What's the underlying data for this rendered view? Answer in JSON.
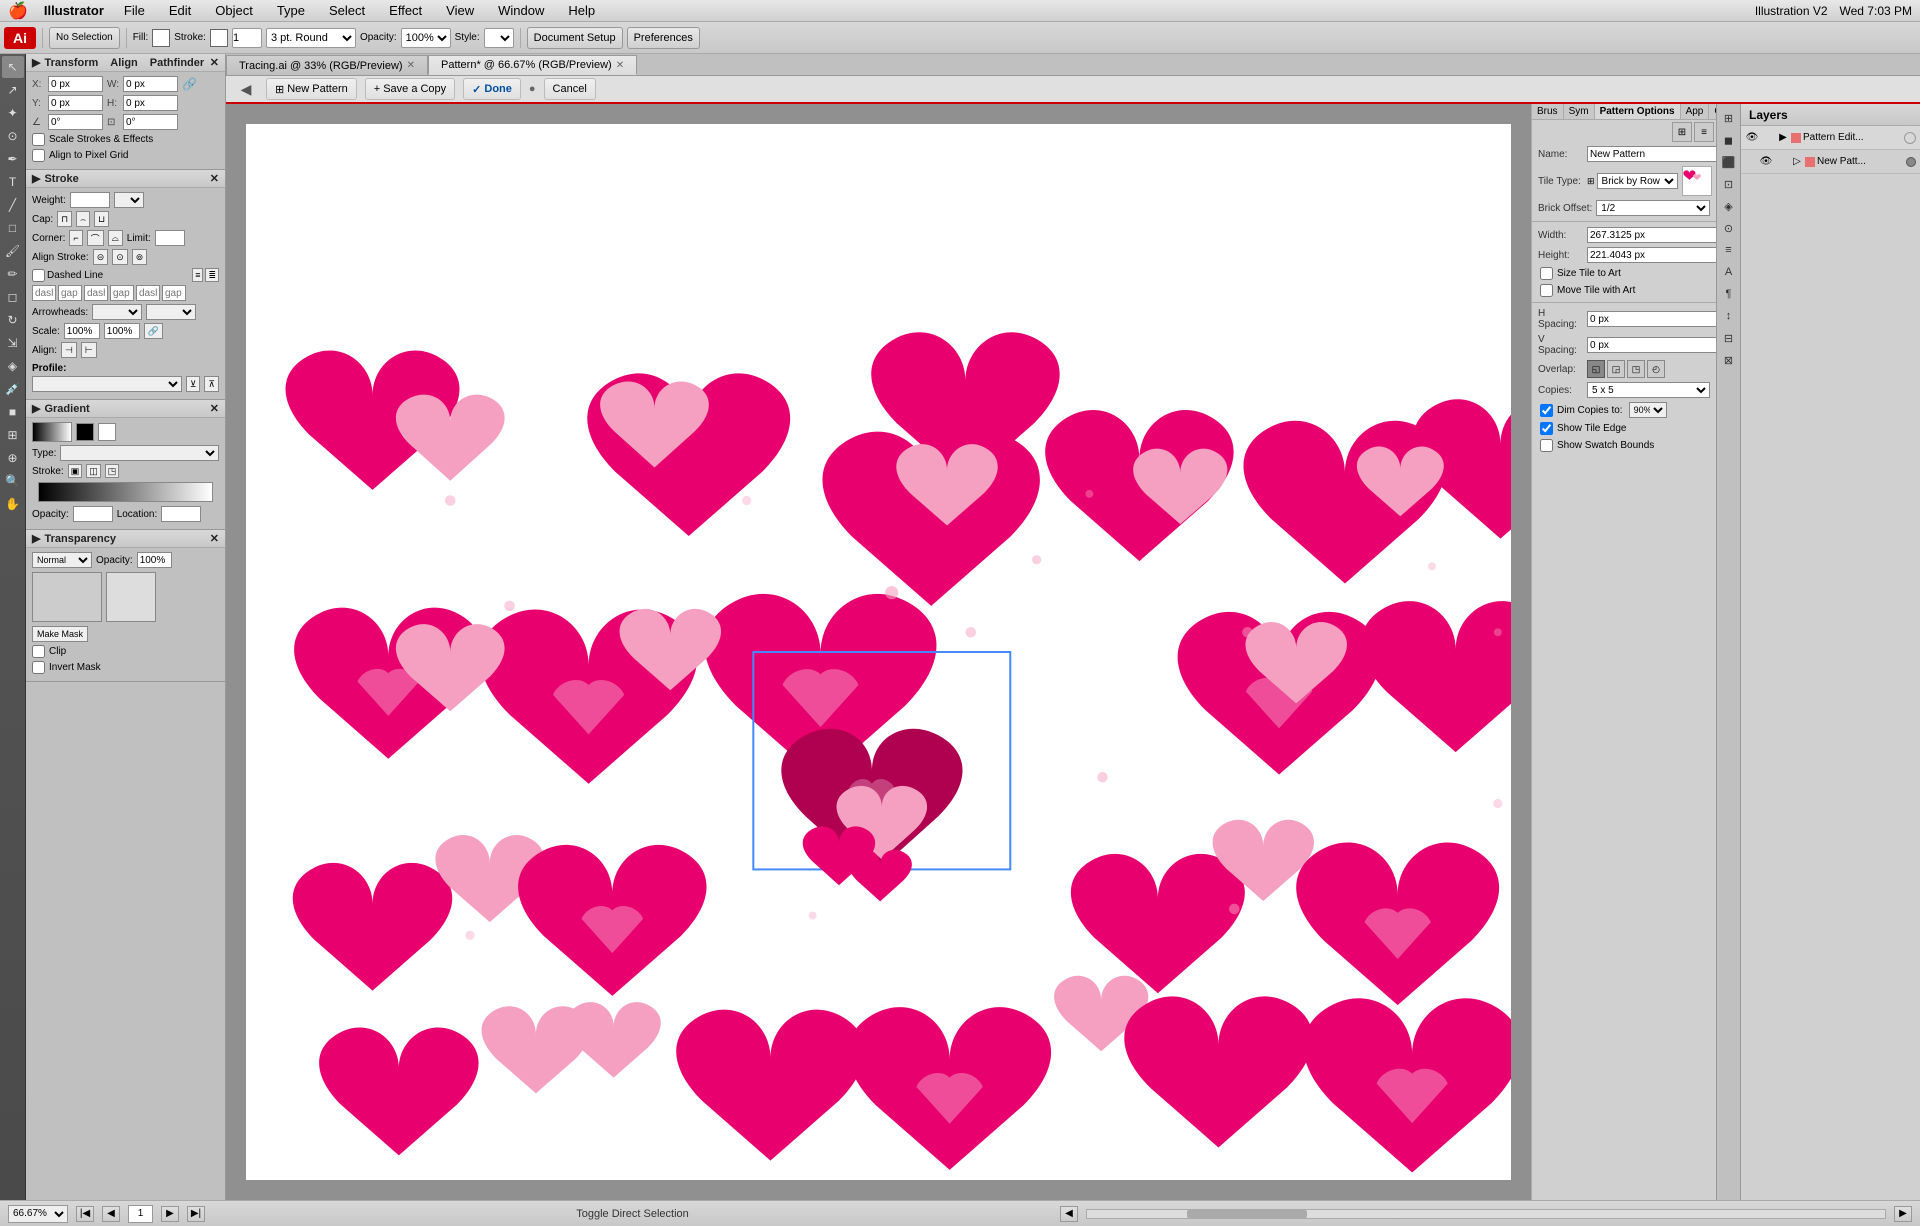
{
  "menubar": {
    "apple": "🍎",
    "app": "Illustrator",
    "menus": [
      "File",
      "Edit",
      "Object",
      "Type",
      "Select",
      "Effect",
      "View",
      "Window",
      "Help"
    ],
    "right": {
      "time": "Wed 7:03 PM",
      "version": "Illustration V2"
    }
  },
  "toolbar": {
    "selection_label": "No Selection",
    "fill_label": "Fill:",
    "stroke_label": "Stroke:",
    "stroke_size": "1",
    "pt_round": "3 pt. Round",
    "opacity_label": "Opacity:",
    "opacity_value": "100%",
    "style_label": "Style:",
    "doc_setup_label": "Document Setup",
    "preferences_label": "Preferences"
  },
  "tabs": [
    {
      "label": "Tracing.ai @ 33% (RGB/Preview)",
      "active": false
    },
    {
      "label": "Pattern* @ 66.67% (RGB/Preview)",
      "active": true
    }
  ],
  "pattern_toolbar": {
    "new_pattern": "New Pattern",
    "save_copy": "Save a Copy",
    "done": "Done",
    "cancel": "Cancel"
  },
  "transform_panel": {
    "title": "Transform",
    "x_label": "X:",
    "x_val": "0 px",
    "y_label": "Y:",
    "y_val": "0 px",
    "w_label": "W:",
    "w_val": "0 px",
    "h_label": "H:",
    "h_val": "0 px",
    "angle_label": "∠",
    "angle_val": "0°",
    "scale_strokes": "Scale Strokes & Effects",
    "align_pixel": "Align to Pixel Grid"
  },
  "stroke_panel": {
    "title": "Stroke",
    "weight_label": "Weight:",
    "cap_label": "Cap:",
    "corner_label": "Corner:",
    "limit_label": "Limit:",
    "align_stroke": "Align Stroke:",
    "dashed_line": "Dashed Line",
    "dash_label": "dash",
    "gap_label": "gap",
    "arrowheads": "Arrowheads:",
    "scale_label": "Scale:",
    "scale_val": "100%",
    "align_label": "Align:"
  },
  "gradient_panel": {
    "title": "Gradient",
    "type_label": "Type:",
    "stroke_label": "Stroke:",
    "opacity_label": "Opacity:",
    "location_label": "Location:"
  },
  "transparency_panel": {
    "title": "Transparency",
    "mode": "Normal",
    "opacity": "100%",
    "make_mask": "Make Mask",
    "clip": "Clip",
    "invert_mask": "Invert Mask"
  },
  "pattern_options": {
    "tabs": [
      "Brus",
      "Sym",
      "Pattern Options",
      "App",
      "Gra"
    ],
    "active_tab": "Pattern Options",
    "name_label": "Name:",
    "name_val": "New Pattern",
    "tile_type_label": "Tile Type:",
    "tile_type_val": "Brick by Row",
    "brick_offset_label": "Brick Offset:",
    "brick_offset_val": "1/2",
    "width_label": "Width:",
    "width_val": "267.3125 px",
    "height_label": "Height:",
    "height_val": "221.4043 px",
    "size_tile_art": "Size Tile to Art",
    "move_tile_art": "Move Tile with Art",
    "h_spacing_label": "H Spacing:",
    "h_spacing_val": "0 px",
    "v_spacing_label": "V Spacing:",
    "v_spacing_val": "0 px",
    "overlap_label": "Overlap:",
    "copies_label": "Copies:",
    "copies_val": "5 x 5",
    "dim_copies": "Dim Copies to:",
    "dim_val": "90%",
    "show_tile_edge": "Show Tile Edge",
    "show_swatch_bounds": "Show Swatch Bounds"
  },
  "layers": {
    "title": "Layers",
    "items": [
      {
        "name": "Pattern Edit...",
        "color": "#e87070",
        "expanded": true,
        "visible": true
      },
      {
        "name": "New Patt...",
        "color": "#e87070",
        "expanded": false,
        "visible": true
      }
    ]
  },
  "statusbar": {
    "zoom": "66.67%",
    "page_label": "1",
    "toggle_label": "Toggle Direct Selection"
  }
}
